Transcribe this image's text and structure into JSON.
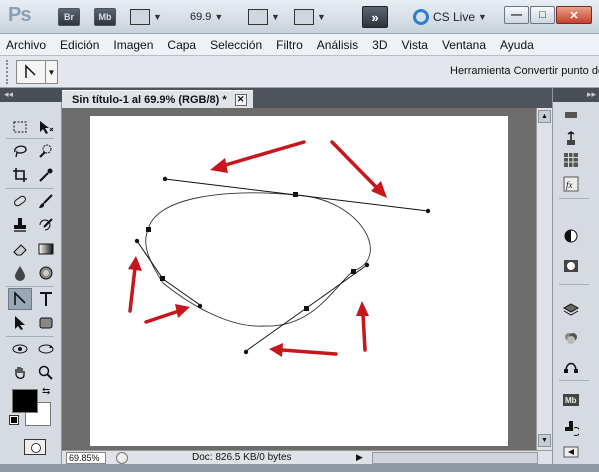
{
  "appbar": {
    "logo": "Ps",
    "bridge_label": "Br",
    "minibridge_label": "Mb",
    "zoom_value": "69.9",
    "arrange_label": "»",
    "cslive_label": "CS Live"
  },
  "window_buttons": {
    "minimize": "—",
    "maximize": "□",
    "close": "✕"
  },
  "menu": {
    "items": [
      "Archivo",
      "Edición",
      "Imagen",
      "Capa",
      "Selección",
      "Filtro",
      "Análisis",
      "3D",
      "Vista",
      "Ventana",
      "Ayuda"
    ]
  },
  "options_bar": {
    "tool_hint": "Herramienta Convertir punto de"
  },
  "panels": {
    "collapse_left": "◂◂",
    "collapse_right": "▸▸"
  },
  "document": {
    "tab_title": "Sin título-1 al 69.9% (RGB/8) *",
    "close_label": "✕"
  },
  "status": {
    "zoom": "69.85%",
    "doc_info": "Doc: 826.5 KB/0 bytes",
    "arrow": "▶"
  },
  "colors": {
    "arrow_red": "#c8161d",
    "foreground": "#000000",
    "background": "#ffffff"
  },
  "tools": [
    "rectangular-marquee",
    "move",
    "lasso",
    "quick-selection",
    "crop",
    "eyedropper",
    "spot-healing-brush",
    "brush",
    "clone-stamp",
    "history-brush",
    "eraser",
    "gradient",
    "blur",
    "dodge",
    "convert-point",
    "type",
    "path-selection",
    "rectangle",
    "3d-rotate",
    "3d-orbit",
    "hand",
    "zoom"
  ],
  "right_panel_icons": [
    "history-icon",
    "actions-icon",
    "swatches-icon",
    "styles-icon",
    "adjustments-icon",
    "masks-icon",
    "layers-icon",
    "channels-icon",
    "paths-icon",
    "mini-bridge-icon",
    "clone-source-icon",
    "panel-collapse-icon"
  ]
}
